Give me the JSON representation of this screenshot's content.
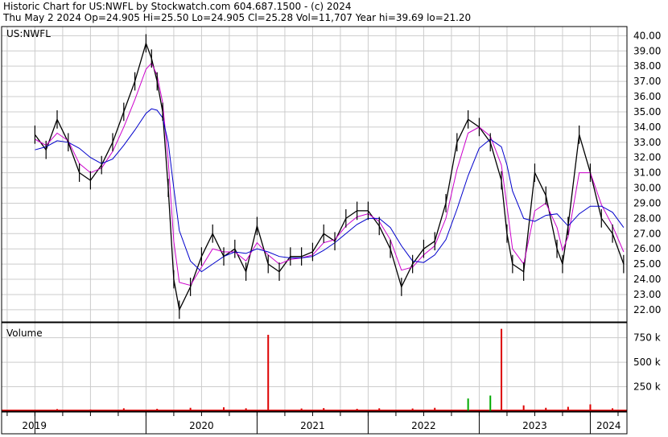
{
  "header": {
    "line1": "Historic Chart for US:NWFL by Stockwatch.com 604.687.1500 - (c) 2024",
    "line2": "Thu May  2 2024   Op=24.905   Hi=25.50   Lo=24.905   Cl=25.28   Vol=11,707   Year hi=39.69   lo=21.20"
  },
  "chart_data": [
    {
      "type": "line",
      "panel": "price",
      "symbol_label": "US:NWFL",
      "ylim": [
        21.2,
        40.6
      ],
      "y_ticks": [
        "40.00",
        "39.00",
        "38.00",
        "37.00",
        "36.00",
        "35.00",
        "34.00",
        "33.00",
        "32.00",
        "31.00",
        "30.00",
        "29.00",
        "28.00",
        "27.00",
        "26.00",
        "25.00",
        "24.00",
        "23.00",
        "22.00"
      ],
      "grid": true,
      "colors": {
        "price": "#000000",
        "ma_short": "#cc00cc",
        "ma_long": "#0000cc",
        "grid": "#cccccc"
      },
      "x": [
        2019.0,
        2019.1,
        2019.2,
        2019.3,
        2019.4,
        2019.5,
        2019.6,
        2019.7,
        2019.8,
        2019.9,
        2020.0,
        2020.05,
        2020.1,
        2020.15,
        2020.2,
        2020.25,
        2020.3,
        2020.4,
        2020.5,
        2020.6,
        2020.7,
        2020.8,
        2020.9,
        2021.0,
        2021.1,
        2021.2,
        2021.3,
        2021.4,
        2021.5,
        2021.6,
        2021.7,
        2021.8,
        2021.9,
        2022.0,
        2022.1,
        2022.2,
        2022.3,
        2022.4,
        2022.5,
        2022.6,
        2022.7,
        2022.8,
        2022.9,
        2023.0,
        2023.1,
        2023.2,
        2023.25,
        2023.3,
        2023.4,
        2023.5,
        2023.6,
        2023.7,
        2023.75,
        2023.8,
        2023.9,
        2024.0,
        2024.1,
        2024.2,
        2024.3
      ],
      "series": [
        {
          "values": [
            33.5,
            32.5,
            34.5,
            33.0,
            31.0,
            30.5,
            31.5,
            33.0,
            35.0,
            37.0,
            39.5,
            38.5,
            37.0,
            35.0,
            30.0,
            24.0,
            22.0,
            23.5,
            25.5,
            27.0,
            25.5,
            26.0,
            24.5,
            27.5,
            25.0,
            24.5,
            25.5,
            25.5,
            25.8,
            27.0,
            26.5,
            28.0,
            28.5,
            28.5,
            27.5,
            26.0,
            23.5,
            25.0,
            26.0,
            26.5,
            29.0,
            33.0,
            34.5,
            34.0,
            33.0,
            30.5,
            27.0,
            25.0,
            24.5,
            31.0,
            29.5,
            26.0,
            25.0,
            27.5,
            33.5,
            31.0,
            28.0,
            27.0,
            25.0
          ]
        },
        {
          "values": [
            33.2,
            32.8,
            33.6,
            33.1,
            31.6,
            31.0,
            31.3,
            32.4,
            34.0,
            35.8,
            37.8,
            38.2,
            37.4,
            35.6,
            31.8,
            26.5,
            23.8,
            23.6,
            24.8,
            26.0,
            25.8,
            25.8,
            25.2,
            26.4,
            25.6,
            25.0,
            25.3,
            25.4,
            25.6,
            26.4,
            26.6,
            27.5,
            28.1,
            28.3,
            27.8,
            26.6,
            24.6,
            24.8,
            25.6,
            26.2,
            28.0,
            31.2,
            33.6,
            34.0,
            33.4,
            31.5,
            28.8,
            26.0,
            25.0,
            28.5,
            29.0,
            27.4,
            25.9,
            26.8,
            31.0,
            31.0,
            28.9,
            27.5,
            25.8
          ]
        },
        {
          "values": [
            32.5,
            32.7,
            33.1,
            33.0,
            32.6,
            32.0,
            31.6,
            31.9,
            32.8,
            33.8,
            34.9,
            35.2,
            35.1,
            34.6,
            33.0,
            30.0,
            27.2,
            25.2,
            24.5,
            25.0,
            25.5,
            25.8,
            25.7,
            26.0,
            25.8,
            25.5,
            25.4,
            25.4,
            25.5,
            25.9,
            26.4,
            27.0,
            27.6,
            28.0,
            28.0,
            27.4,
            26.2,
            25.2,
            25.1,
            25.6,
            26.6,
            28.6,
            30.8,
            32.6,
            33.2,
            32.7,
            31.5,
            29.8,
            28.0,
            27.8,
            28.2,
            28.3,
            27.9,
            27.5,
            28.3,
            28.8,
            28.8,
            28.4,
            27.4
          ]
        }
      ]
    },
    {
      "type": "bar",
      "panel": "volume",
      "label": "Volume",
      "y_ticks": [
        "750 k",
        "500 k",
        "250 k"
      ],
      "ylim": [
        0,
        870
      ],
      "colors": {
        "up": "#00aa00",
        "down": "#dd0000"
      },
      "x": [
        2019.2,
        2019.5,
        2019.8,
        2020.1,
        2020.4,
        2020.7,
        2020.9,
        2021.1,
        2021.4,
        2021.6,
        2021.9,
        2022.1,
        2022.4,
        2022.6,
        2022.9,
        2023.1,
        2023.2,
        2023.4,
        2023.6,
        2023.8,
        2024.0,
        2024.2
      ],
      "values": [
        22,
        18,
        30,
        25,
        35,
        40,
        30,
        780,
        28,
        32,
        25,
        30,
        28,
        35,
        130,
        160,
        840,
        60,
        35,
        45,
        70,
        30
      ]
    }
  ],
  "x_axis": {
    "year_labels": [
      "2019",
      "2020",
      "2021",
      "2022",
      "2023",
      "2024"
    ],
    "year_starts": [
      2019.0,
      2020.0,
      2021.0,
      2022.0,
      2023.0,
      2024.0
    ],
    "xlim": [
      2018.7,
      2024.33
    ]
  }
}
